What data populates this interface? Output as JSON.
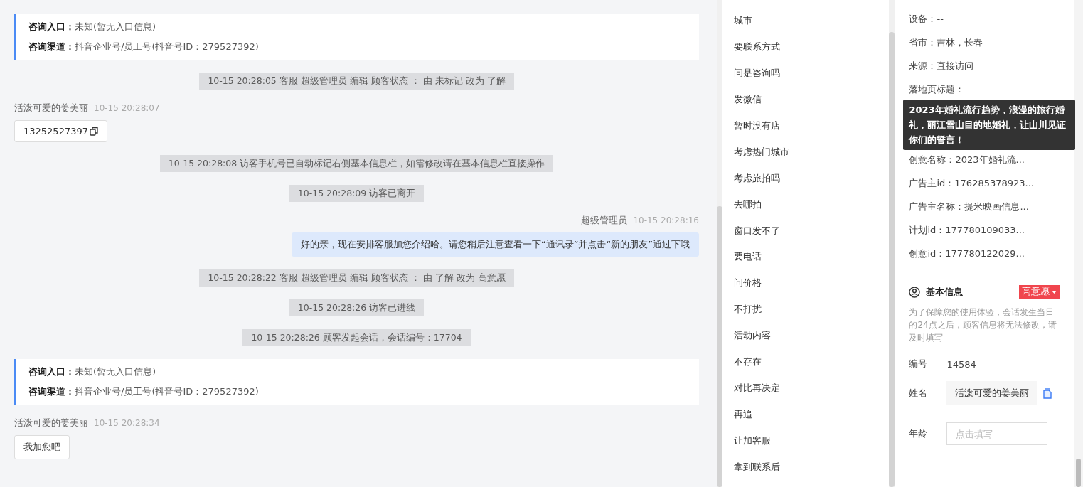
{
  "chat": {
    "messages": [
      {
        "kind": "entry_card",
        "entry_label": "咨询入口：",
        "entry_value": "未知(暂无入口信息)",
        "channel_label": "咨询渠道：",
        "channel_value": "抖音企业号/员工号(抖音号ID：279527392)"
      },
      {
        "kind": "system",
        "text": "10-15 20:28:05 客服 超级管理员 编辑 顾客状态 ： 由 未标记 改为 了解"
      },
      {
        "kind": "visitor",
        "name": "活泼可爱的姜美丽",
        "time": "10-15 20:28:07",
        "text": "13252527397",
        "copyable": true
      },
      {
        "kind": "system",
        "text": "10-15 20:28:08 访客手机号已自动标记右侧基本信息栏，如需修改请在基本信息栏直接操作"
      },
      {
        "kind": "system",
        "text": "10-15 20:28:09 访客已离开"
      },
      {
        "kind": "agent",
        "name": "超级管理员",
        "time": "10-15 20:28:16",
        "text": "好的亲，现在安排客服加您介绍哈。请您稍后注意查看一下“通讯录”并点击“新的朋友”通过下哦"
      },
      {
        "kind": "system",
        "text": "10-15 20:28:22 客服 超级管理员 编辑 顾客状态 ： 由 了解 改为 高意愿"
      },
      {
        "kind": "system",
        "text": "10-15 20:28:26 访客已进线"
      },
      {
        "kind": "system",
        "text": "10-15 20:28:26 顾客发起会话，会话编号：17704"
      },
      {
        "kind": "entry_card",
        "entry_label": "咨询入口：",
        "entry_value": "未知(暂无入口信息)",
        "channel_label": "咨询渠道：",
        "channel_value": "抖音企业号/员工号(抖音号ID：279527392)"
      },
      {
        "kind": "visitor",
        "name": "活泼可爱的姜美丽",
        "time": "10-15 20:28:34",
        "text": "我加您吧",
        "copyable": false
      }
    ]
  },
  "tags": [
    "城市",
    "要联系方式",
    "问是咨询吗",
    "发微信",
    "暂时没有店",
    "考虑热门城市",
    "考虑旅拍吗",
    "去哪拍",
    "窗口发不了",
    "要电话",
    "问价格",
    "不打扰",
    "活动内容",
    "不存在",
    "对比再决定",
    "再追",
    "让加客服",
    "拿到联系后"
  ],
  "info": {
    "rows": [
      {
        "kind": "text",
        "text": "设备：--"
      },
      {
        "kind": "text",
        "text": "省市：吉林，长春"
      },
      {
        "kind": "text",
        "text": "来源：直接访问"
      },
      {
        "kind": "text",
        "text": "落地页标题：--"
      },
      {
        "kind": "covered"
      },
      {
        "kind": "covered"
      },
      {
        "kind": "text",
        "text": "创意名称：2023年婚礼流..."
      },
      {
        "kind": "text",
        "text": "广告主id：176285378923..."
      },
      {
        "kind": "text",
        "text": "广告主名称：提米映画信息..."
      },
      {
        "kind": "text",
        "text": "计划id：177780109033..."
      },
      {
        "kind": "text",
        "text": "创意id：177780122029..."
      }
    ],
    "tooltip": "2023年婚礼流行趋势，浪漫的旅行婚礼，丽江雪山目的地婚礼，让山川见证你们的誓言！"
  },
  "basic_info": {
    "title": "基本信息",
    "status": "高意愿",
    "notice": "为了保障您的使用体验，会话发生当日的24点之后，顾客信息将无法修改，请及时填写",
    "fields": [
      {
        "kind": "text",
        "label": "编号",
        "value": "14584"
      },
      {
        "kind": "readonly",
        "label": "姓名",
        "value": "活泼可爱的姜美丽",
        "copyable": true
      },
      {
        "kind": "input",
        "label": "年龄",
        "placeholder": "点击填写"
      }
    ]
  }
}
